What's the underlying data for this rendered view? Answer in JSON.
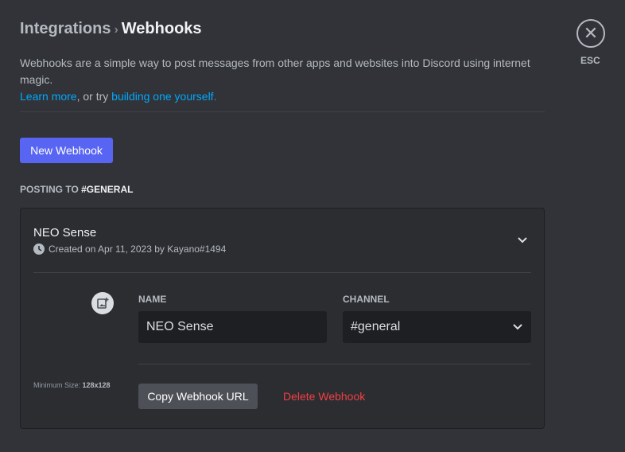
{
  "breadcrumb": {
    "parent": "Integrations",
    "separator": "›",
    "current": "Webhooks"
  },
  "description": {
    "text": "Webhooks are a simple way to post messages from other apps and websites into Discord using internet magic.",
    "learn_more": "Learn more",
    "middle": ", or try ",
    "build_link": "building one yourself."
  },
  "new_webhook": "New Webhook",
  "posting": {
    "label": "POSTING TO ",
    "channel": "#GENERAL"
  },
  "esc": {
    "label": "ESC",
    "icon": "close-icon"
  },
  "webhook": {
    "name": "NEO Sense",
    "created": "Created on Apr 11, 2023 by Kayano#1494",
    "name_label": "NAME",
    "name_value": "NEO Sense",
    "channel_label": "CHANNEL",
    "channel_value": "#general",
    "min_size_label": "Minimum Size: ",
    "min_size_value": "128x128",
    "copy_url": "Copy Webhook URL",
    "delete": "Delete Webhook"
  }
}
